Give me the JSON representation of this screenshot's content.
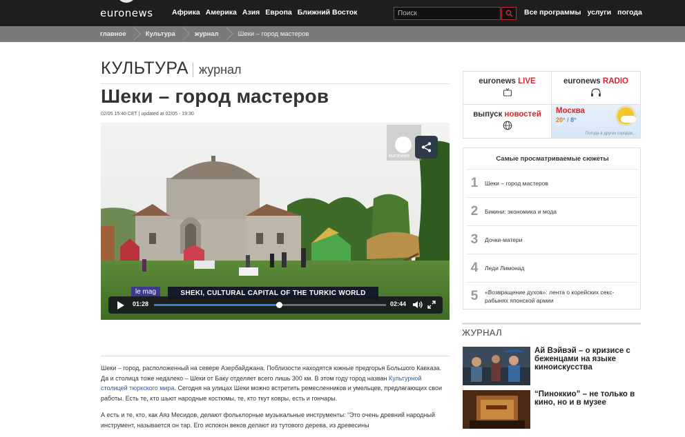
{
  "brand": {
    "logo_text": "euronews"
  },
  "nav": {
    "main": [
      "Африка",
      "Америка",
      "Азия",
      "Европа",
      "Ближний Восток"
    ],
    "right": [
      "Все программы",
      "услуги",
      "погода"
    ]
  },
  "search": {
    "placeholder": "Поиск"
  },
  "breadcrumbs": [
    "главное",
    "Культура",
    "журнал",
    "Шеки – город мастеров"
  ],
  "section": {
    "title": "КУЛЬТУРА",
    "subtitle": "журнал"
  },
  "article": {
    "headline": "Шеки – город мастеров",
    "dateline": "02/05 15:40 CET | updated at 02/05 - 19:30",
    "credit": "",
    "body": {
      "p1_before_link": "Шеки – город, расположенный на севере Азербайджана. Поблизости находятся южные предгорья Большого Кавказа. Да и столица тоже недалеко – Шеки от Баку отделяет всего лишь 300 км. В этом году город назван ",
      "p1_link": "Культурной столицей тюркского мира",
      "p1_after_link": ". Сегодня на улицах Шеки можно встретить ремесленников и умельцев, предлагающих свои работы. Есть те, кто шьют народные костюмы, те, кто ткут ковры, есть и гончары.",
      "p2": "А есть и те, кто, как Аяз Месидов, делают фольклорные музыкальные инструменты: “Это очень древний народный инструмент, называется он тар. Его испокон веков делают из тутового дерева, из древесины"
    }
  },
  "video": {
    "tag": "le mag",
    "caption": "SHEKI, CULTURAL CAPITAL OF THE TURKIC WORLD",
    "current_time": "01:28",
    "total_time": "02:44",
    "progress": 0.54,
    "watermark": "euronews"
  },
  "sidebar": {
    "tiles": {
      "live_prefix": "euronews ",
      "live_accent": "LIVE",
      "radio_prefix": "euronews ",
      "radio_accent": "RADIO",
      "news_prefix": "выпуск ",
      "news_accent": "новостей",
      "weather_city": "Москва",
      "weather_high": "20°",
      "weather_sep": " / ",
      "weather_low": "8°",
      "weather_more": "Погода в других городах..."
    },
    "popular_title": "Самые просматриваемые сюжеты",
    "popular": [
      {
        "num": "1",
        "title": "Шеки – город мастеров"
      },
      {
        "num": "2",
        "title": "Бикини: экономика и мода"
      },
      {
        "num": "3",
        "title": "Дочки-матери"
      },
      {
        "num": "4",
        "title": "Леди Лимонад"
      },
      {
        "num": "5",
        "title": "«Возвращение духов»: лента о корейских секс-рабынях японской армии"
      }
    ],
    "journal_title": "ЖУРНАЛ",
    "journal": [
      {
        "title": "Ай Вэйвэй – о кризисе с беженцами на языке киноискусства"
      },
      {
        "title": "“Пиноккио” – не только в кино, но и в музее"
      }
    ]
  },
  "colors": {
    "accent": "#d8262c",
    "topbar": "#1e1e1e",
    "crumbbar": "#7a7a7a",
    "link": "#2a5ea8"
  }
}
